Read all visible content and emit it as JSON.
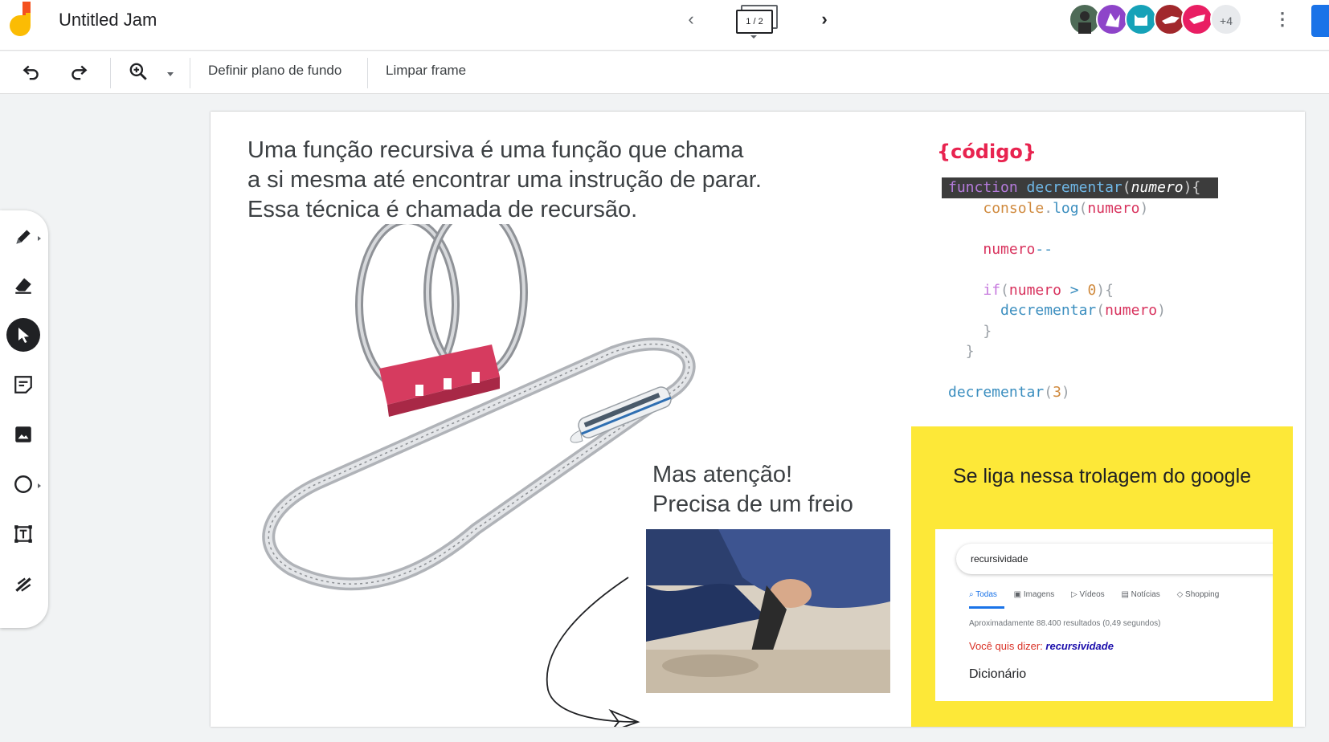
{
  "app": {
    "title": "Untitled Jam"
  },
  "frame_nav": {
    "indicator": "1 / 2",
    "current": 1,
    "total": 2
  },
  "collaborators": {
    "more_count": "+4"
  },
  "toolbar": {
    "set_background": "Definir plano de fundo",
    "clear_frame": "Limpar frame"
  },
  "side_tools": [
    "pen",
    "eraser",
    "select",
    "sticky-note",
    "image",
    "circle",
    "text-box",
    "laser"
  ],
  "slide": {
    "intro_text": "Uma função recursiva é uma função que chama a si mesma até encontrar uma instrução de parar. Essa técnica é chamada de recursão.",
    "warning_line1": "Mas atenção!",
    "warning_line2": "Precisa de um freio",
    "code_title": "{código}",
    "yellow_title": "Se liga nessa trolagem do google",
    "google": {
      "query": "recursividade",
      "tabs": [
        "Todas",
        "Imagens",
        "Vídeos",
        "Notícias",
        "Shopping"
      ],
      "stats": "Aproximadamente 88.400 resultados (0,49 segundos)",
      "did_you_mean_label": "Você quis dizer:",
      "did_you_mean_term": "recursividade",
      "dictionary": "Dicionário"
    }
  },
  "colors": {
    "accent": "#1a73e8",
    "code_title": "#e8234f",
    "yellow_card": "#fde838",
    "track_support": "#d63b5f"
  }
}
